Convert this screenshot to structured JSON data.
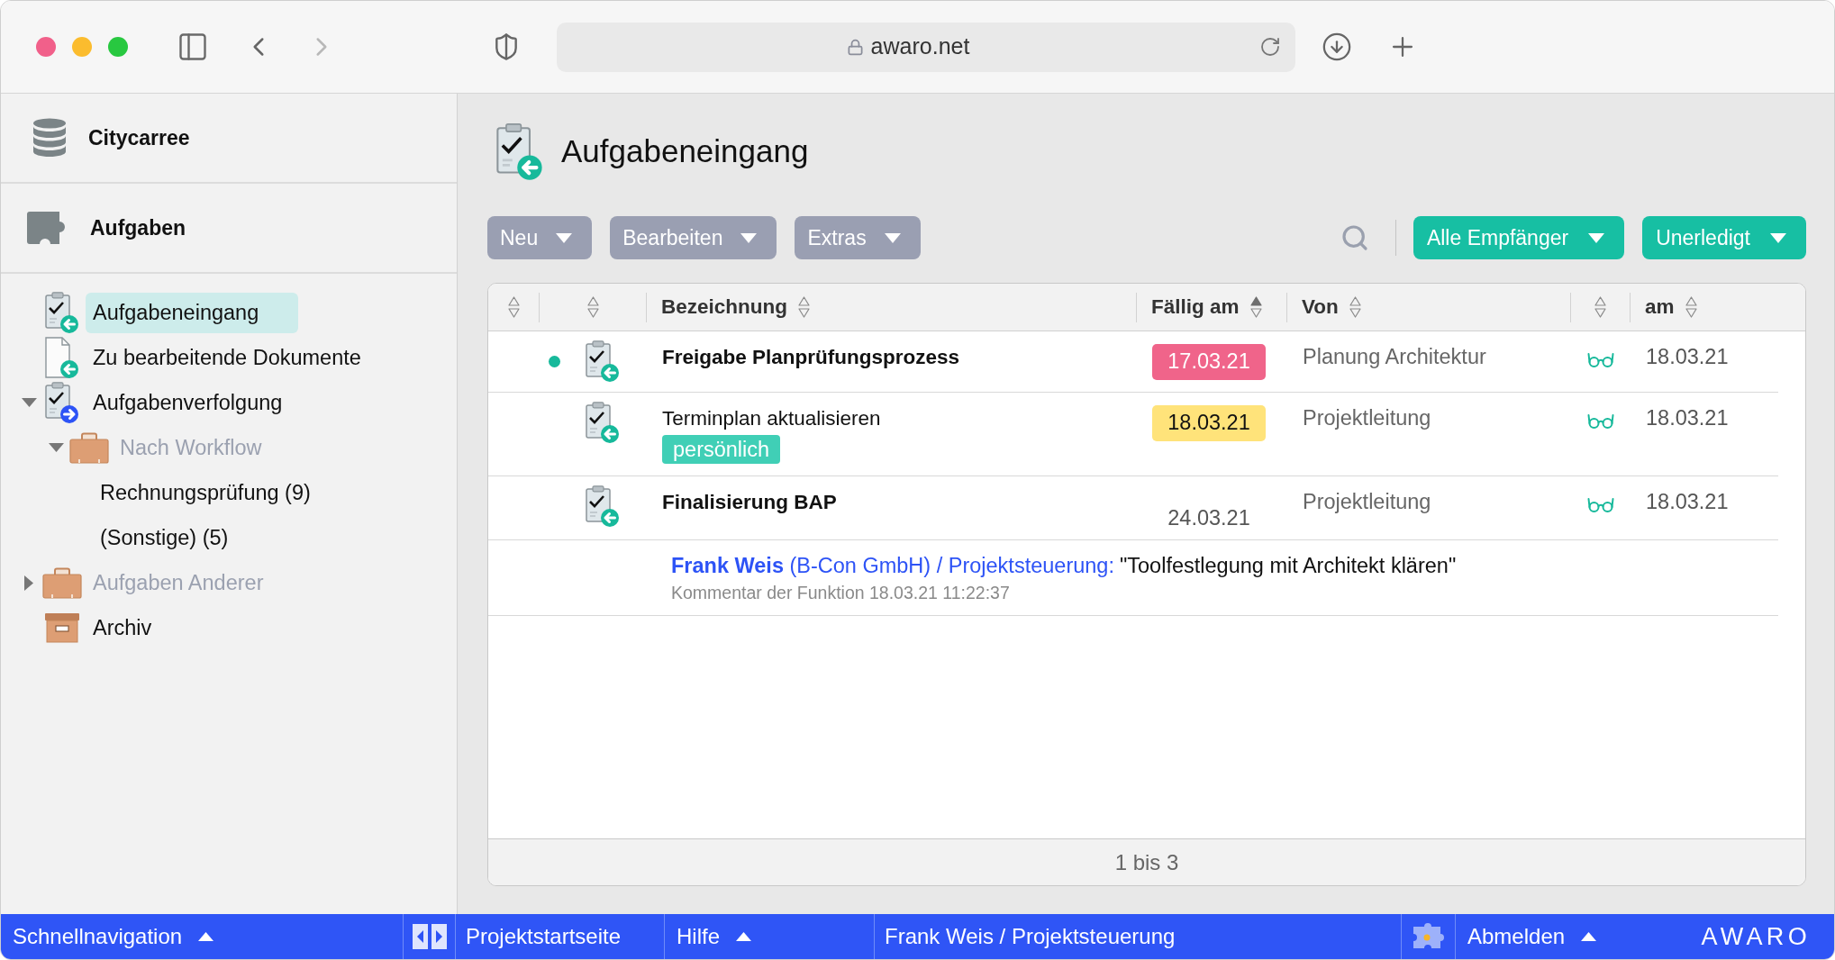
{
  "browser": {
    "url": "awaro.net",
    "back": {
      "disabled": false
    },
    "forward": {
      "disabled": true
    }
  },
  "sidebar": {
    "project": "Citycarree",
    "module": "Aufgaben",
    "tree": [
      {
        "kind": "inbox",
        "label": "Aufgabeneingang",
        "selected": true,
        "disabled": false
      },
      {
        "kind": "document",
        "label": "Zu bearbeitende Dokumente",
        "selected": false,
        "disabled": false
      },
      {
        "kind": "outbox",
        "label": "Aufgabenverfolgung",
        "selected": false,
        "disabled": false,
        "expanded": true,
        "children": [
          {
            "kind": "folder",
            "label": "Nach Workflow",
            "selected": false,
            "disabled": true,
            "expanded": true,
            "children": [
              {
                "label": "Rechnungsprüfung (9)",
                "selected": false,
                "disabled": false
              },
              {
                "label": "(Sonstige) (5)",
                "selected": false,
                "disabled": false
              }
            ]
          }
        ]
      },
      {
        "kind": "folder",
        "label": "Aufgaben Anderer",
        "selected": false,
        "disabled": true,
        "expanded": false
      },
      {
        "kind": "archive",
        "label": "Archiv",
        "selected": false,
        "disabled": false
      }
    ]
  },
  "page": {
    "title": "Aufgabeneingang"
  },
  "toolbar": {
    "menus": [
      "Neu",
      "Bearbeiten",
      "Extras"
    ],
    "filters": [
      "Alle Empfänger",
      "Unerledigt"
    ]
  },
  "table": {
    "columns": [
      {
        "sorted": false
      },
      {
        "sorted": false
      },
      {
        "label": "Bezeichnung",
        "sorted": false
      },
      {
        "label": "Fällig am",
        "sorted": true
      },
      {
        "label": "Von",
        "sorted": false
      },
      {
        "sorted": false
      },
      {
        "label": "am",
        "sorted": false
      }
    ],
    "rows": [
      {
        "new": true,
        "kind": "inbox",
        "title": "Freigabe Planprüfungsprozess",
        "bold": true,
        "due": {
          "date": "17.03.21",
          "color": "#f0648a"
        },
        "from": "Planung Architektur",
        "date": "18.03.21"
      },
      {
        "new": false,
        "kind": "inbox",
        "title": "Terminplan aktualisieren",
        "bold": false,
        "tag": "persönlich",
        "due": {
          "date": "18.03.21",
          "color": "#ffe37a"
        },
        "from": "Projektleitung",
        "date": "18.03.21"
      },
      {
        "new": false,
        "kind": "inbox",
        "title": "Finalisierung BAP",
        "bold": true,
        "due": {
          "date": "24.03.21"
        },
        "from": "Projektleitung",
        "date": "18.03.21"
      }
    ],
    "comment": {
      "author": "**Frank Weis** (B-Con GmbH) / Projektsteuerung:",
      "text": "\"Toolfestlegung mit Architekt klären\"",
      "meta": "Kommentar der Funktion 18.03.21 11:22:37"
    },
    "footer": "1 bis 3"
  },
  "bottom_bar": {
    "items": [
      {
        "kind": "menu",
        "label": "Schnellnavigation"
      },
      {
        "kind": "panel-toggle"
      },
      {
        "kind": "link",
        "label": "Projektstartseite"
      },
      {
        "kind": "menu",
        "label": "Hilfe"
      },
      {
        "kind": "link",
        "label": "Frank Weis / Projektsteuerung"
      },
      {
        "kind": "plugin"
      },
      {
        "kind": "menu",
        "label": "Abmelden"
      }
    ],
    "logo": "AWARO"
  }
}
